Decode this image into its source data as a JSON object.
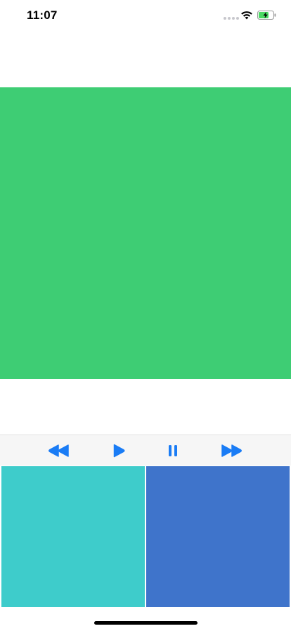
{
  "status_bar": {
    "time": "11:07",
    "wifi_icon": "wifi-icon",
    "battery_icon": "battery-charging-icon"
  },
  "colors": {
    "top_panel": "#3ecd74",
    "bottom_left_panel": "#3ecccb",
    "bottom_right_panel": "#3f74cb",
    "toolbar_tint": "#1a7cf5",
    "toolbar_background": "#f6f6f6"
  },
  "toolbar": {
    "buttons": [
      {
        "icon": "rewind-icon"
      },
      {
        "icon": "play-icon"
      },
      {
        "icon": "pause-icon"
      },
      {
        "icon": "fast-forward-icon"
      }
    ]
  }
}
